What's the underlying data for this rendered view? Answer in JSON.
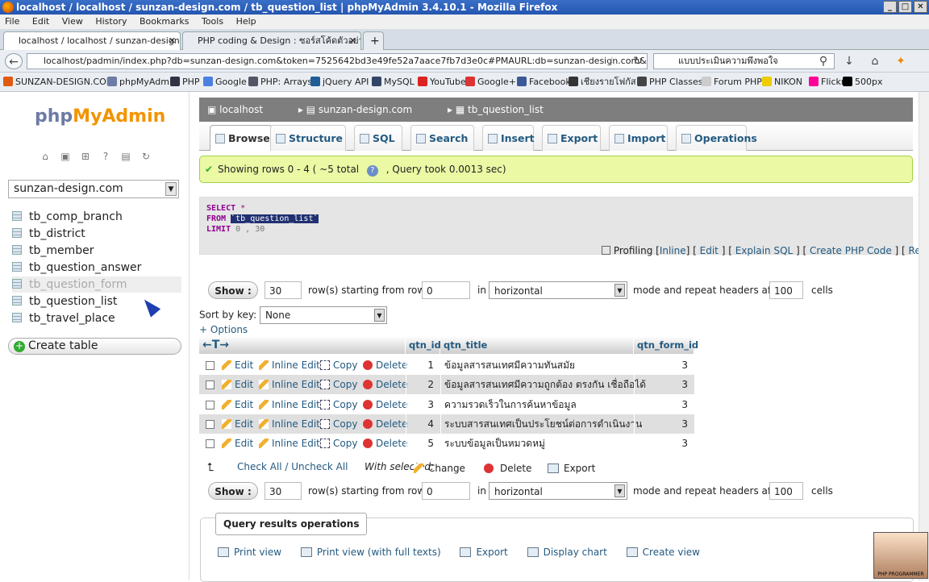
{
  "window": {
    "title": "localhost / localhost / sunzan-design.com / tb_question_list | phpMyAdmin 3.4.10.1 - Mozilla Firefox"
  },
  "menu": [
    "File",
    "Edit",
    "View",
    "History",
    "Bookmarks",
    "Tools",
    "Help"
  ],
  "tabs": [
    {
      "label": "localhost / localhost / sunzan-design.com..."
    },
    {
      "label": "PHP coding & Design : ซอร์สโค้ดตัวอย่าง : ..."
    }
  ],
  "url": "localhost/padmin/index.php?db=sunzan-design.com&token=7525642bd3e49fe52a7aace7fb7d3e0c#PMAURL:db=sunzan-design.com&table=tb_question_list&t...",
  "search_value": "แบบประเมินความพึงพอใจ",
  "bookmarks": [
    {
      "label": "SUNZAN-DESIGN.COM",
      "color": "#e05a10"
    },
    {
      "label": "phpMyAdmin",
      "color": "#6c7ca4"
    },
    {
      "label": "PHP",
      "color": "#334"
    },
    {
      "label": "Google",
      "color": "#4a80e0"
    },
    {
      "label": "PHP: Arrays",
      "color": "#556"
    },
    {
      "label": "jQuery API",
      "color": "#1f5d96"
    },
    {
      "label": "MySQL",
      "color": "#346"
    },
    {
      "label": "YouTube",
      "color": "#d22"
    },
    {
      "label": "Google+",
      "color": "#d33"
    },
    {
      "label": "Facebook",
      "color": "#3b5998"
    },
    {
      "label": "เชียงรายโฟกัส",
      "color": "#333"
    },
    {
      "label": "PHP Classes",
      "color": "#444"
    },
    {
      "label": "Forum PHP",
      "color": "#ccc"
    },
    {
      "label": "NIKON",
      "color": "#ec0"
    },
    {
      "label": "Flickr",
      "color": "#f09"
    },
    {
      "label": "500px",
      "color": "#000"
    }
  ],
  "sidebar": {
    "logo_a": "php",
    "logo_b": "MyAdmin",
    "db": "sunzan-design.com",
    "tables": [
      "tb_comp_branch",
      "tb_district",
      "tb_member",
      "tb_question_answer",
      "tb_question_form",
      "tb_question_list",
      "tb_travel_place"
    ],
    "create_table": "Create table"
  },
  "breadcrumb": [
    "localhost",
    "sunzan-design.com",
    "tb_question_list"
  ],
  "main_tabs": [
    "Browse",
    "Structure",
    "SQL",
    "Search",
    "Insert",
    "Export",
    "Import",
    "Operations"
  ],
  "success": "Showing rows 0 - 4 ( ~5 total",
  "success_time": ", Query took 0.0013 sec)",
  "sql": {
    "select": "SELECT",
    "star": "*",
    "from": "FROM",
    "table": "`tb_question_list`",
    "limit": "LIMIT",
    "lim_vals": "0 , 30"
  },
  "profiling": {
    "label": "Profiling",
    "links": [
      "Inline",
      "Edit",
      "Explain SQL",
      "Create PHP Code",
      "Refresh"
    ]
  },
  "nav": {
    "show": "Show :",
    "rows": "30",
    "rows_label": "row(s) starting from row #",
    "start": "0",
    "in": "in",
    "mode": "horizontal",
    "mode_label": "mode and repeat headers after",
    "repeat": "100",
    "cells": "cells"
  },
  "sort": {
    "label": "Sort by key:",
    "value": "None"
  },
  "options": "+ Options",
  "grid": {
    "headers": [
      "qtn_id",
      "qtn_title",
      "qtn_form_id"
    ],
    "actions": [
      "Edit",
      "Inline Edit",
      "Copy",
      "Delete"
    ],
    "rows": [
      {
        "id": "1",
        "title": "ข้อมูลสารสนเทศมีความทันสมัย",
        "form": "3"
      },
      {
        "id": "2",
        "title": "ข้อมูลสารสนเทศมีความถูกต้อง ตรงกัน เชื่อถือได้",
        "form": "3"
      },
      {
        "id": "3",
        "title": "ความรวดเร็วในการค้นหาข้อมูล",
        "form": "3"
      },
      {
        "id": "4",
        "title": "ระบบสารสนเทศเป็นประโยชน์ต่อการดำเนินงาน",
        "form": "3"
      },
      {
        "id": "5",
        "title": "ระบบข้อมูลเป็นหมวดหมู่",
        "form": "3"
      }
    ]
  },
  "withsel": {
    "check": "Check All / Uncheck All",
    "with": "With selected:",
    "change": "Change",
    "delete": "Delete",
    "export": "Export"
  },
  "qro": {
    "legend": "Query results operations",
    "links": [
      "Print view",
      "Print view (with full texts)",
      "Export",
      "Display chart",
      "Create view"
    ]
  },
  "avatar_caption": "PHP PROGRAMMER"
}
